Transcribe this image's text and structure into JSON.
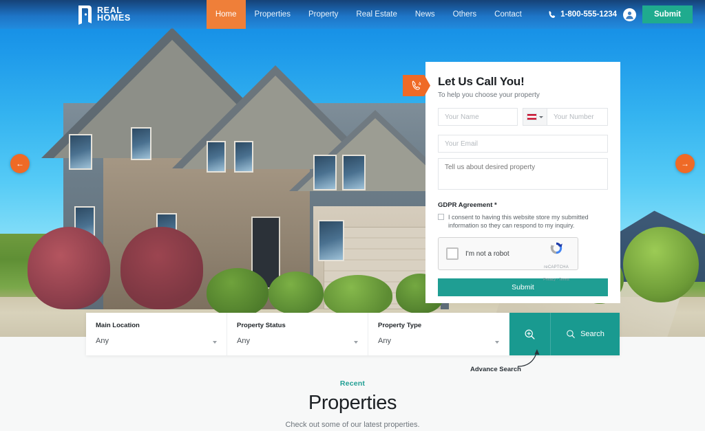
{
  "header": {
    "logo": {
      "line1": "REAL",
      "line2": "HOMES",
      "icon": "door-logo-icon"
    },
    "nav": [
      {
        "label": "Home",
        "active": true
      },
      {
        "label": "Properties",
        "active": false
      },
      {
        "label": "Property",
        "active": false
      },
      {
        "label": "Real Estate",
        "active": false
      },
      {
        "label": "News",
        "active": false
      },
      {
        "label": "Others",
        "active": false
      },
      {
        "label": "Contact",
        "active": false
      }
    ],
    "phone": "1-800-555-1234",
    "phone_icon": "phone-icon",
    "account_icon": "user-account-icon",
    "submit_label": "Submit",
    "accent_orange": "#ef7f39",
    "accent_teal": "#1fab8e"
  },
  "hero": {
    "prev_icon": "arrow-left-icon",
    "next_icon": "arrow-right-icon"
  },
  "callback_form": {
    "tag_icon": "phone-ring-icon",
    "title": "Let Us Call You!",
    "subtitle": "To help you choose your property",
    "name_placeholder": "Your Name",
    "number_placeholder": "Your Number",
    "email_placeholder": "Your Email",
    "message_placeholder": "Tell us about desired property",
    "flag_icon": "country-flag-icon",
    "gdpr_title": "GDPR Agreement *",
    "gdpr_text": "I consent to having this website store my submitted information so they can respond to my inquiry.",
    "recaptcha_label": "I'm not a robot",
    "recaptcha_brand": "reCAPTCHA",
    "recaptcha_terms": "Privacy - Terms",
    "submit_label": "Submit",
    "submit_color": "#1f9e93"
  },
  "search_bar": {
    "fields": [
      {
        "label": "Main Location",
        "value": "Any"
      },
      {
        "label": "Property Status",
        "value": "Any"
      },
      {
        "label": "Property Type",
        "value": "Any"
      }
    ],
    "advance_icon": "zoom-in-icon",
    "search_icon": "search-icon",
    "search_label": "Search",
    "annotation": "Advance Search",
    "button_color": "#199a90"
  },
  "recent_section": {
    "kicker": "Recent",
    "title": "Properties",
    "subtitle": "Check out some of our latest properties.",
    "kicker_color": "#1f9e93"
  }
}
